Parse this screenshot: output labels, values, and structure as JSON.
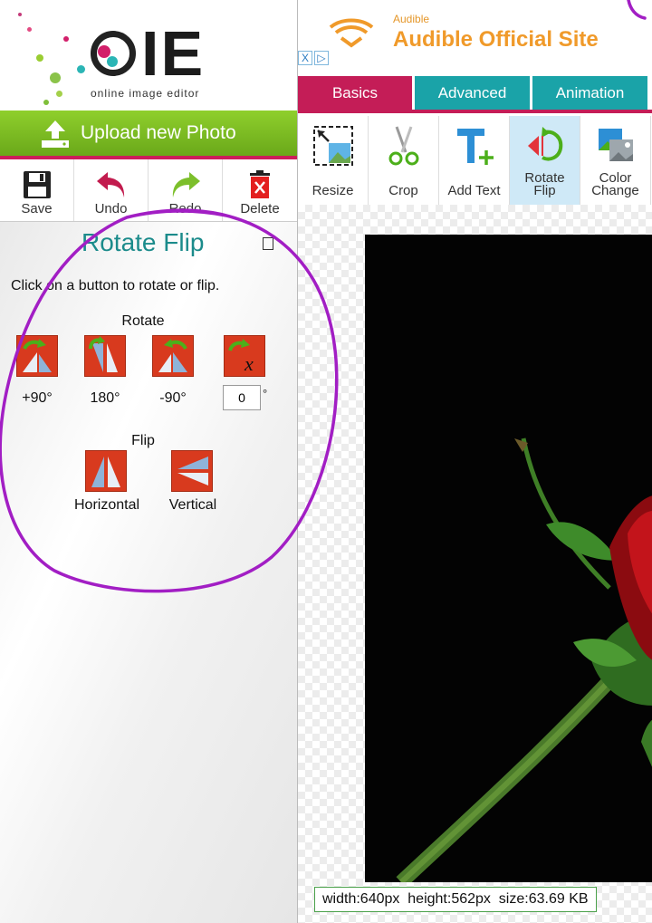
{
  "app": {
    "logo_letters": "IE",
    "logo_tagline": "online image editor",
    "upload_label": "Upload new Photo"
  },
  "toolbar": [
    {
      "label": "Save",
      "icon": "floppy-disk-icon"
    },
    {
      "label": "Undo",
      "icon": "undo-arrow-icon"
    },
    {
      "label": "Redo",
      "icon": "redo-arrow-icon"
    },
    {
      "label": "Delete",
      "icon": "trash-icon"
    }
  ],
  "panel": {
    "title": "Rotate Flip",
    "instructions": "Click on a button to rotate or flip.",
    "rotate_heading": "Rotate",
    "rotate_buttons": [
      {
        "label": "+90°"
      },
      {
        "label": "180°"
      },
      {
        "label": "-90°"
      }
    ],
    "custom_degree_value": "0",
    "degree_sign": "°",
    "flip_heading": "Flip",
    "flip_buttons": [
      {
        "label": "Horizontal"
      },
      {
        "label": "Vertical"
      }
    ]
  },
  "ad": {
    "brand": "Audible",
    "title": "Audible Official Site",
    "close_mark": "X",
    "adchoices_mark": "▷"
  },
  "tabs": [
    {
      "label": "Basics",
      "active": true
    },
    {
      "label": "Advanced",
      "active": false
    },
    {
      "label": "Animation",
      "active": false
    }
  ],
  "ribbon": [
    {
      "label": "Resize",
      "active": false
    },
    {
      "label": "Crop",
      "active": false
    },
    {
      "label": "Add Text",
      "active": false
    },
    {
      "label_line1": "Rotate",
      "label_line2": "Flip",
      "active": true
    },
    {
      "label_line1": "Color",
      "label_line2": "Change",
      "active": false
    }
  ],
  "status": {
    "text": "width:640px  height:562px  size:63.69 KB"
  },
  "colors": {
    "accent_pink": "#c41d57",
    "tab_teal": "#1aa3a8",
    "upload_green": "#78b81f",
    "title_teal": "#1b8b8b",
    "button_red": "#d83a1e",
    "annotation_purple": "#a21ec4"
  }
}
